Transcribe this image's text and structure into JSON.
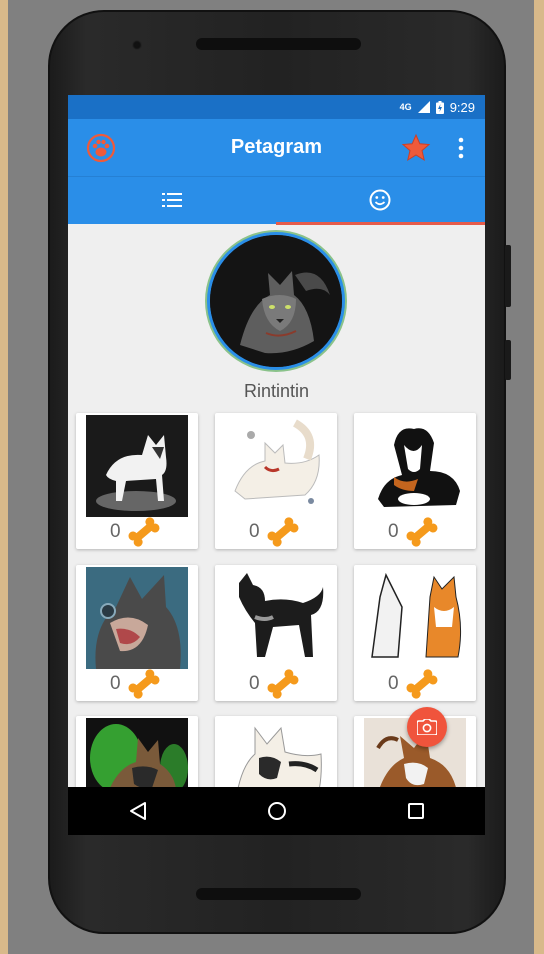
{
  "status_bar": {
    "network": "4G",
    "time": "9:29"
  },
  "app_bar": {
    "title": "Petagram",
    "logo_icon": "paw-icon",
    "favorites_icon": "star-icon",
    "menu_icon": "more-vert-icon"
  },
  "tabs": [
    {
      "icon": "list-icon",
      "selected": false
    },
    {
      "icon": "smiley-icon",
      "selected": true
    }
  ],
  "profile": {
    "name": "Rintintin"
  },
  "photos": [
    {
      "likes": "0",
      "like_icon": "bone-icon"
    },
    {
      "likes": "0",
      "like_icon": "bone-icon"
    },
    {
      "likes": "0",
      "like_icon": "bone-icon"
    },
    {
      "likes": "0",
      "like_icon": "bone-icon"
    },
    {
      "likes": "0",
      "like_icon": "bone-icon"
    },
    {
      "likes": "0",
      "like_icon": "bone-icon"
    },
    {
      "likes": "",
      "like_icon": "bone-icon"
    },
    {
      "likes": "",
      "like_icon": "bone-icon"
    },
    {
      "likes": "",
      "like_icon": "bone-icon"
    }
  ],
  "fab": {
    "icon": "camera-icon"
  },
  "nav_bar": {
    "back_icon": "back-triangle-icon",
    "home_icon": "home-circle-icon",
    "recents_icon": "recents-square-icon"
  },
  "colors": {
    "primary": "#2a8ee8",
    "primary_dark": "#1a70c6",
    "accent": "#f0543c",
    "bone": "#f59a1c"
  }
}
